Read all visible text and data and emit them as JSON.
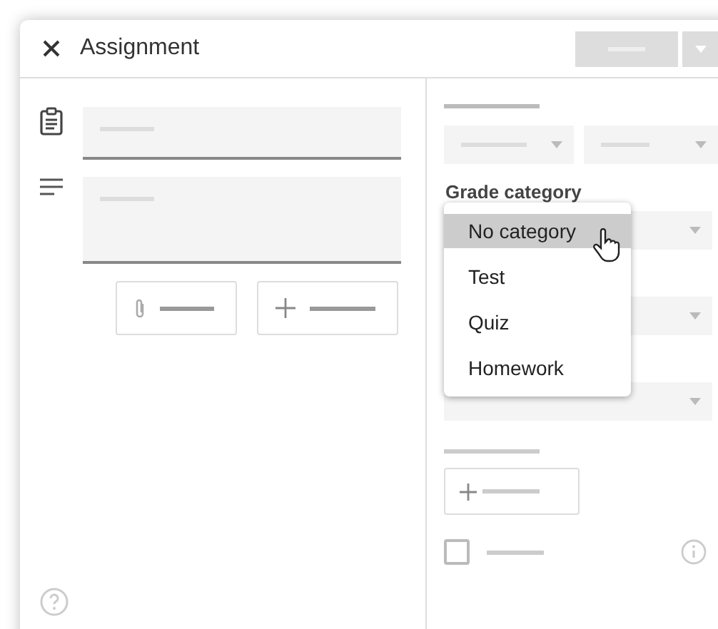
{
  "window": {
    "title": "Assignment"
  },
  "grade_category": {
    "label": "Grade category",
    "menu": [
      {
        "label": "No category",
        "selected": true
      },
      {
        "label": "Test",
        "selected": false
      },
      {
        "label": "Quiz",
        "selected": false
      },
      {
        "label": "Homework",
        "selected": false
      }
    ]
  },
  "due_checkbox": {
    "checked": false
  }
}
